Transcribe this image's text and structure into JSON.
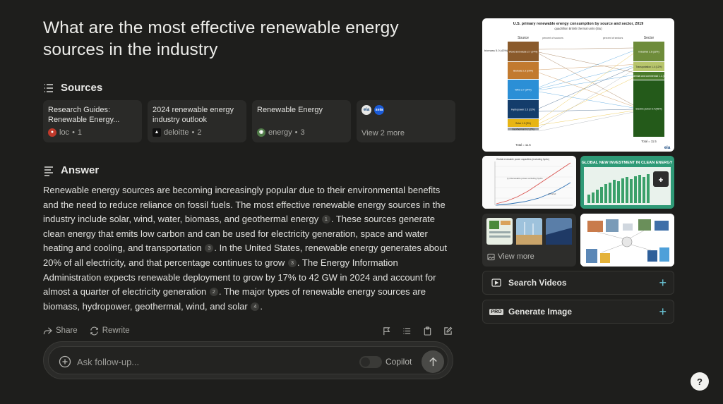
{
  "query": {
    "title": "What are the most effective renewable energy sources in the industry"
  },
  "sources": {
    "heading": "Sources",
    "items": [
      {
        "title": "Research Guides: Renewable Energy...",
        "site": "loc",
        "index": "1",
        "favicon_color": "#c0392b"
      },
      {
        "title": "2024 renewable energy industry outlook",
        "site": "deloitte",
        "index": "2",
        "favicon_color": "#111111"
      },
      {
        "title": "Renewable Energy",
        "site": "energy",
        "index": "3",
        "favicon_color": "#4f7a47"
      }
    ],
    "more": {
      "label": "View 2 more",
      "icon1_text": "eia",
      "icon2_text": "seia"
    }
  },
  "answer": {
    "heading": "Answer",
    "p1": "Renewable energy sources are becoming increasingly popular due to their environmental benefits and the need to reduce reliance on fossil fuels. The most effective renewable energy sources in the industry include solar, wind, water, biomass, and geothermal energy",
    "c1": "1",
    "p2": ". These sources generate clean energy that emits low carbon and can be used for electricity generation, space and water heating and cooling, and transportation",
    "c2": "3",
    "p3": ". In the United States, renewable energy generates about 20% of all electricity, and that percentage continues to grow",
    "c3": "3",
    "p4": ". The Energy Information Administration expects renewable deployment to grow by 17% to 42 GW in 2024 and account for almost a quarter of electricity generation",
    "c4": "2",
    "p5": ". The major types of renewable energy sources are biomass, hydropower, geothermal, wind, and solar",
    "c5": "4",
    "p6": "."
  },
  "actions": {
    "share": "Share",
    "rewrite": "Rewrite"
  },
  "followup": {
    "placeholder": "Ask follow-up...",
    "copilot_label": "Copilot",
    "copilot_on": false
  },
  "side": {
    "main_chart": {
      "title": "U.S. primary renewable energy consumption by source and sector, 2019",
      "subtitle": "quadrillion British thermal units (Btu)",
      "source_col": "Source",
      "sector_col": "Sector",
      "pct_sources": "percent of sources",
      "pct_sectors": "percent of sectors",
      "sources": [
        {
          "label": "Wood and waste 2.7 (24%)",
          "color": "#8a5a2b"
        },
        {
          "label": "Biofuels 2.3 (20%)",
          "color": "#c27a2f"
        },
        {
          "label": "Wind 2.7 (24%)",
          "color": "#2b8fd6"
        },
        {
          "label": "Hydropower 2.5 (22%)",
          "color": "#143d6b"
        },
        {
          "label": "Solar 1.0 (9%)",
          "color": "#e7b514"
        },
        {
          "label": "Geothermal 0.2 (2%)",
          "color": "#9aa0a6"
        }
      ],
      "biomass_label": "biomass 5.0 (43%)",
      "sectors": [
        {
          "label": "Industrial 2.5 (22%)",
          "color": "#6e8c3a"
        },
        {
          "label": "Transportation 1.4 (12%)",
          "color": "#b7c56b"
        },
        {
          "label": "Residential and commercial 1.1 (10%)",
          "color": "#4a7a2a"
        },
        {
          "label": "Electric power 6.4 (56%)",
          "color": "#245a1a"
        }
      ],
      "total_left": "Total = 11.5",
      "total_right": "Total = 11.5",
      "logo": "eia"
    },
    "chart_b_title": "GLOBAL NEW INVESTMENT IN CLEAN ENERGY",
    "chart_a_labels": [
      "Global renewable power capacities (excluding hydro)",
      "(1) Renewable power excluding hydro",
      "(2) Wind"
    ],
    "view_more": "View more",
    "search_videos": "Search Videos",
    "generate_image": "Generate Image",
    "pro_badge": "PRO"
  },
  "help": "?",
  "colors": {
    "accent": "#6bc7d8",
    "background": "#1e1e1c",
    "card": "#2a2a28"
  }
}
